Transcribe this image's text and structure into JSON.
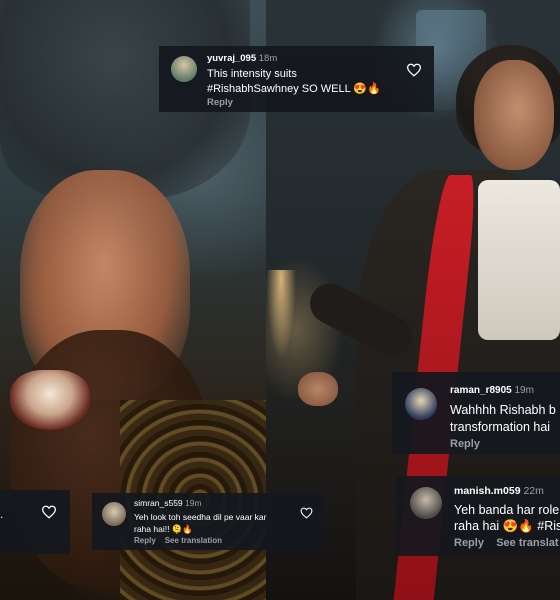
{
  "comments": [
    {
      "username": "yuvraj_095",
      "time": "18m",
      "lines": [
        "This intensity suits",
        "#RishabhSawhney SO WELL 😍🔥"
      ],
      "actions": [
        "Reply"
      ],
      "icon": "heart-outline-icon"
    },
    {
      "username": "raman_r8905",
      "time": "19m",
      "lines": [
        "Wahhhh Rishabh b",
        "transformation hai"
      ],
      "actions": [
        "Reply"
      ]
    },
    {
      "lines": [
        "g."
      ],
      "icon": "heart-outline-icon"
    },
    {
      "username": "simran_s559",
      "time": "19m",
      "lines": [
        "Yeh look toh seedha dil pe vaar kar",
        "raha hai!! 🫠🔥"
      ],
      "actions": [
        "Reply",
        "See translation"
      ],
      "icon": "heart-outline-icon"
    },
    {
      "username": "manish.m059",
      "time": "22m",
      "lines": [
        "Yeh banda har role",
        "raha hai 😍🔥 #Ris"
      ],
      "actions": [
        "Reply",
        "See translat"
      ]
    }
  ]
}
